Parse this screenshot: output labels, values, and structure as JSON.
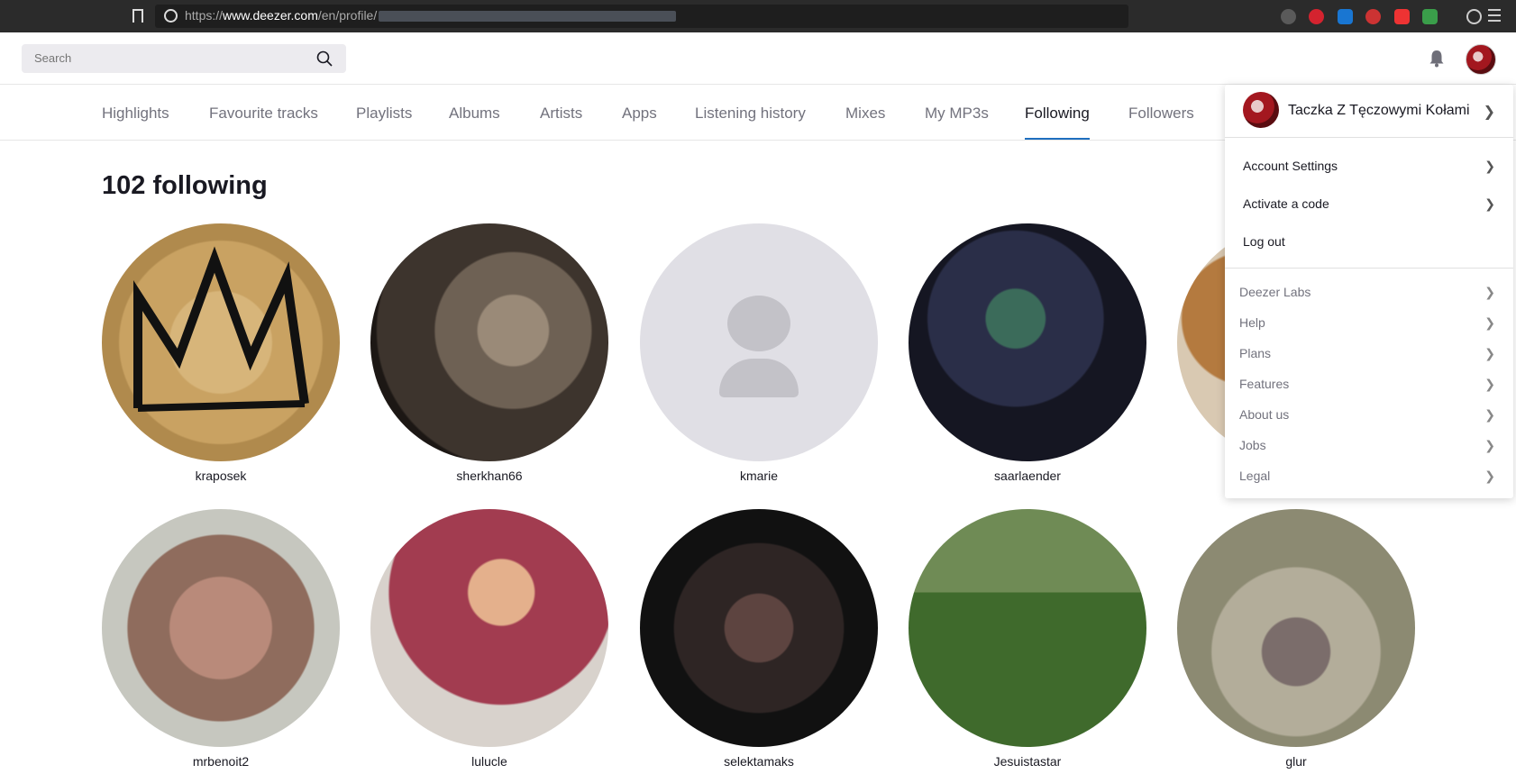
{
  "browser": {
    "url_prefix": "https://",
    "url_domain": "www.deezer.com",
    "url_path": "/en/profile/"
  },
  "topbar": {
    "search_placeholder": "Search"
  },
  "tabs": [
    {
      "label": "Highlights"
    },
    {
      "label": "Favourite tracks"
    },
    {
      "label": "Playlists"
    },
    {
      "label": "Albums"
    },
    {
      "label": "Artists"
    },
    {
      "label": "Apps"
    },
    {
      "label": "Listening history"
    },
    {
      "label": "Mixes"
    },
    {
      "label": "My MP3s"
    },
    {
      "label": "Following"
    },
    {
      "label": "Followers"
    }
  ],
  "active_tab": "Following",
  "main": {
    "count_title": "102 following"
  },
  "users": [
    {
      "name": "kraposek"
    },
    {
      "name": "sherkhan66"
    },
    {
      "name": "kmarie"
    },
    {
      "name": "saarlaender"
    },
    {
      "name": ""
    },
    {
      "name": "mrbenoit2"
    },
    {
      "name": "lulucle"
    },
    {
      "name": "selektamaks"
    },
    {
      "name": "Jesuistastar"
    },
    {
      "name": "glur"
    }
  ],
  "dropdown": {
    "user_name": "Taczka Z Tęczowymi Kołami",
    "account_items": [
      {
        "label": "Account Settings"
      },
      {
        "label": "Activate a code"
      },
      {
        "label": "Log out"
      }
    ],
    "minor_items": [
      {
        "label": "Deezer Labs"
      },
      {
        "label": "Help"
      },
      {
        "label": "Plans"
      },
      {
        "label": "Features"
      },
      {
        "label": "About us"
      },
      {
        "label": "Jobs"
      },
      {
        "label": "Legal"
      }
    ]
  },
  "colors": {
    "accent": "#1f6fbf",
    "text": "#191922",
    "muted": "#72727d"
  }
}
